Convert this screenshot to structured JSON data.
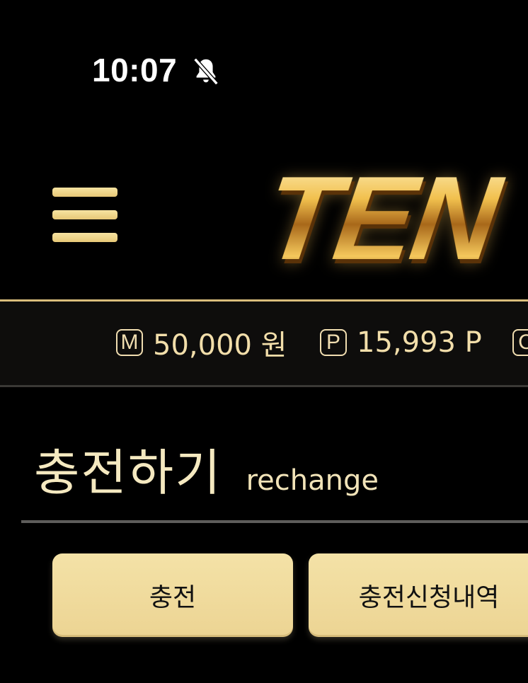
{
  "status_bar": {
    "time": "10:07",
    "notification_icon": "bell-off-icon"
  },
  "header": {
    "logo_text": "TEN",
    "menu_icon": "hamburger-menu-icon"
  },
  "balances": [
    {
      "icon_letter": "M",
      "value": "50,000 원"
    },
    {
      "icon_letter": "P",
      "value": "15,993 P"
    },
    {
      "icon_letter": "C",
      "value": ""
    }
  ],
  "page": {
    "title": "충전하기",
    "subtitle": "rechange"
  },
  "tabs": {
    "charge": "충전",
    "history": "충전신청내역"
  },
  "colors": {
    "background": "#000000",
    "gold": "#e8c97a",
    "button": "#f1dc9c"
  }
}
